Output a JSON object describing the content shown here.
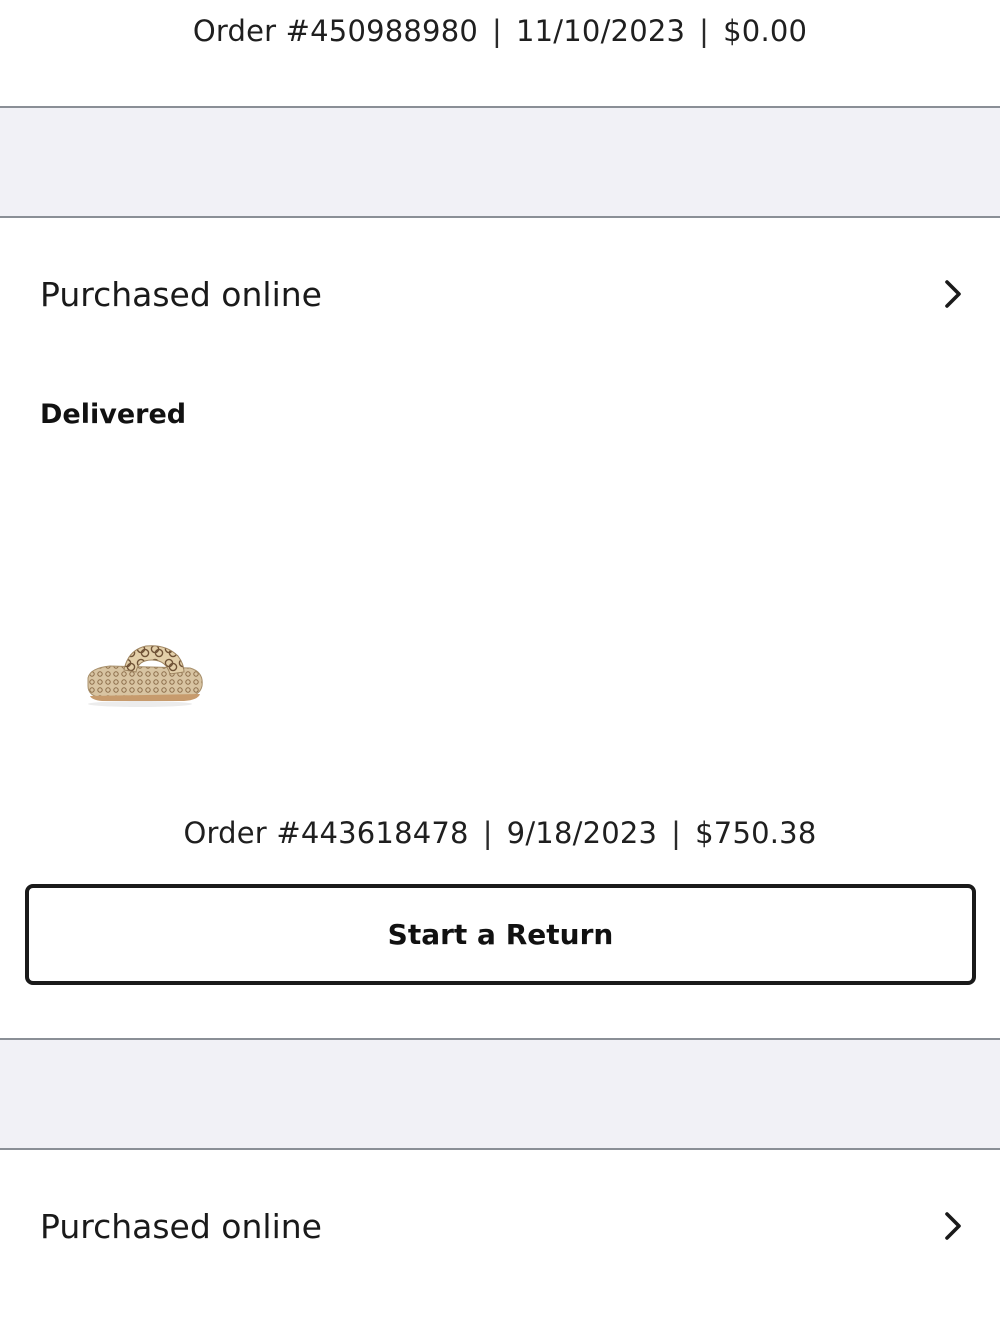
{
  "orders": [
    {
      "order_number": "Order #450988980",
      "date": "11/10/2023",
      "total": "$0.00",
      "separator": "|"
    },
    {
      "purchase_channel": "Purchased online",
      "status": "Delivered",
      "product_image_alt": "platform sandal",
      "order_number": "Order #443618478",
      "date": "9/18/2023",
      "total": "$750.38",
      "separator": "|",
      "return_button_label": "Start a Return"
    },
    {
      "purchase_channel": "Purchased online"
    }
  ],
  "icons": {
    "row_chevron": "chevron-right-icon"
  },
  "colors": {
    "band_background": "#f1f1f6",
    "band_border": "#8a8f96",
    "text": "#1a1a1a",
    "button_border": "#1a1a1a"
  }
}
